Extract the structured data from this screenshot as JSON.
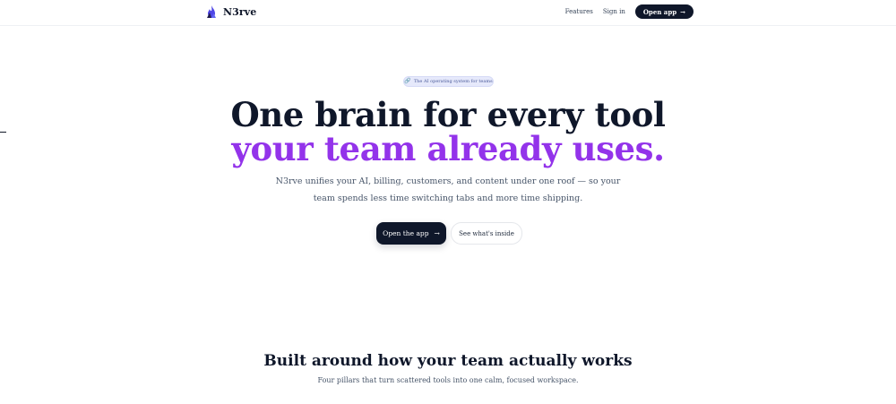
{
  "header": {
    "brand": "N3rve",
    "nav": {
      "features": "Features",
      "sign_in": "Sign in",
      "open_app": "Open app",
      "open_app_arrow": "→"
    }
  },
  "hero": {
    "badge": {
      "icon": "🔗",
      "text": "The AI operating system for teams"
    },
    "title_line1": "One brain for every tool",
    "title_line2": "your team already uses.",
    "subtitle_line1": "N3rve unifies your AI, billing, customers, and content under one roof — so your",
    "subtitle_line2": "team spends less time switching tabs and more time shipping.",
    "primary_cta": "Open the app",
    "primary_cta_arrow": "→",
    "secondary_cta": "See what's inside"
  },
  "section": {
    "title": "Built around how your team actually works",
    "subtitle": "Four pillars that turn scattered tools into one calm, focused workspace."
  },
  "colors": {
    "brand_dark": "#0f172a",
    "accent_purple": "#9333ea",
    "badge_bg": "#e6e9fb"
  }
}
